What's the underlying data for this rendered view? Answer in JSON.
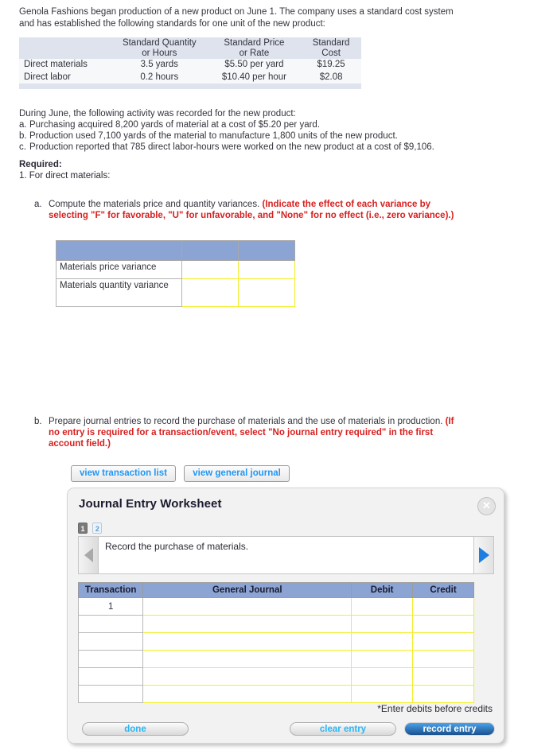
{
  "intro": {
    "paragraph": "Genola Fashions began production of a new product on June 1. The company uses a standard cost system and has established the following standards for one unit of the new product:"
  },
  "standards_table": {
    "headers": [
      "",
      "Standard Quantity or Hours",
      "Standard Price or Rate",
      "Standard Cost"
    ],
    "header_lines": {
      "col2_line1": "Standard Quantity",
      "col2_line2": "or Hours",
      "col3_line1": "Standard Price",
      "col3_line2": "or Rate",
      "col4_line1": "Standard",
      "col4_line2": "Cost"
    },
    "rows": [
      {
        "label": "Direct materials",
        "quantity": "3.5 yards",
        "price": "$5.50 per yard",
        "cost": "$19.25"
      },
      {
        "label": "Direct labor",
        "quantity": "0.2 hours",
        "price": "$10.40 per hour",
        "cost": "$2.08"
      }
    ]
  },
  "activity": {
    "lead": "During June, the following activity was recorded for the new product:",
    "items": [
      {
        "letter": "a.",
        "text": "Purchasing acquired 8,200 yards of material at a cost of $5.20 per yard."
      },
      {
        "letter": "b.",
        "text": "Production used 7,100 yards of the material to manufacture 1,800 units of the new product."
      },
      {
        "letter": "c.",
        "text": "Production reported that 785 direct labor-hours were worked on the new product at a cost of $9,106."
      }
    ]
  },
  "required": {
    "heading": "Required:",
    "item1": "1.  For direct materials:"
  },
  "part_a": {
    "marker": "a.",
    "text_plain": "Compute the materials price and quantity variances. ",
    "text_red_line1": "(Indicate the effect of each variance by",
    "text_red_line2": "selecting \"F\" for favorable, \"U\" for unfavorable, and \"None\" for no effect (i.e., zero variance).)"
  },
  "variance_table": {
    "headers": [
      "",
      "",
      ""
    ],
    "rows": [
      {
        "label": "Materials price variance",
        "amount": "",
        "effect": ""
      },
      {
        "label": "Materials quantity variance",
        "amount": "",
        "effect": ""
      }
    ]
  },
  "part_b": {
    "marker": "b.",
    "text_plain": "Prepare journal entries to record the purchase of materials and the use of materials in production. ",
    "text_red_line1": "(If",
    "text_red_line2": "no entry is required for a transaction/event, select \"No journal entry required\" in the first",
    "text_red_line3": "account field.)"
  },
  "view_buttons": [
    {
      "label": "view transaction list"
    },
    {
      "label": "view general journal"
    }
  ],
  "journal_dialog": {
    "title": "Journal Entry Worksheet",
    "close_icon": "close-circle-icon",
    "tabs": [
      {
        "label": "1",
        "state": "active"
      },
      {
        "label": "2",
        "state": "inactive"
      }
    ],
    "prompt": "Record the purchase of materials.",
    "prev_arrow_icon": "triangle-left-icon",
    "next_arrow_icon": "triangle-right-icon",
    "grid": {
      "headers": [
        "Transaction",
        "General Journal",
        "Debit",
        "Credit"
      ],
      "rows": [
        {
          "transaction": "1",
          "general_journal": "",
          "debit": "",
          "credit": ""
        },
        {
          "transaction": "",
          "general_journal": "",
          "debit": "",
          "credit": ""
        },
        {
          "transaction": "",
          "general_journal": "",
          "debit": "",
          "credit": ""
        },
        {
          "transaction": "",
          "general_journal": "",
          "debit": "",
          "credit": ""
        },
        {
          "transaction": "",
          "general_journal": "",
          "debit": "",
          "credit": ""
        },
        {
          "transaction": "",
          "general_journal": "",
          "debit": "",
          "credit": ""
        }
      ]
    },
    "note": "*Enter debits before credits",
    "buttons": {
      "done": "done",
      "clear_entry": "clear entry",
      "record_entry": "record entry"
    }
  },
  "colors": {
    "header_blue": "#8ba4d4",
    "table_header_grey": "#dfe3ee",
    "input_yellow": "#f2ef2a",
    "link_blue": "#2196f3",
    "red_instruction": "#d81f1f",
    "record_entry_blue": "#19508f"
  }
}
